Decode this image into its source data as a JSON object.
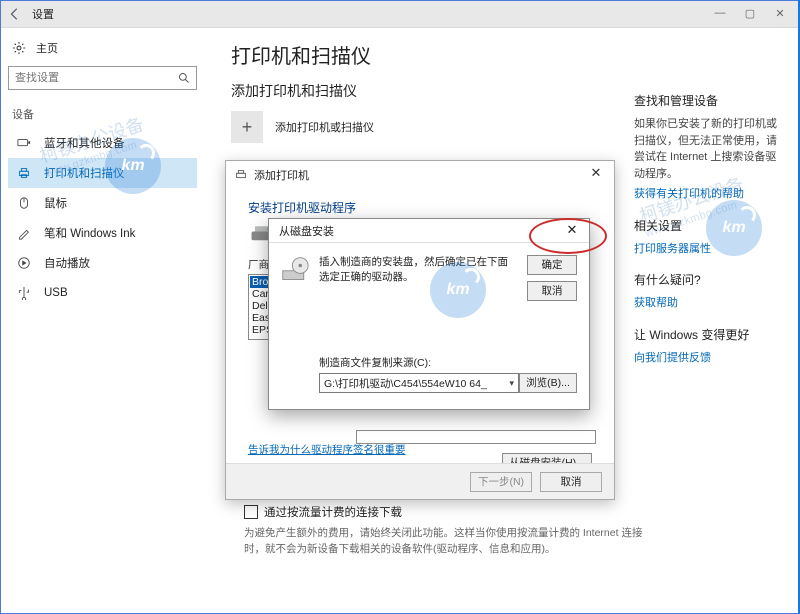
{
  "titlebar": {
    "title": "设置"
  },
  "home": {
    "label": "主页"
  },
  "search": {
    "placeholder": "查找设置"
  },
  "section_label": "设备",
  "nav": {
    "bluetooth": "蓝牙和其他设备",
    "printers": "打印机和扫描仪",
    "mouse": "鼠标",
    "pen": "笔和 Windows Ink",
    "autoplay": "自动播放",
    "usb": "USB"
  },
  "main": {
    "h1": "打印机和扫描仪",
    "h2": "添加打印机和扫描仪",
    "add_label": "添加打印机或扫描仪"
  },
  "right": {
    "h_manage": "查找和管理设备",
    "manage_text": "如果你已安装了新的打印机或扫描仪，但无法正常使用，请尝试在 Internet 上搜索设备驱动程序。",
    "link_help": "获得有关打印机的帮助",
    "h_related": "相关设置",
    "link_server": "打印服务器属性",
    "h_question": "有什么疑问?",
    "link_gethelp": "获取帮助",
    "h_better": "让 Windows 变得更好",
    "link_feedback": "向我们提供反馈"
  },
  "metered": {
    "label": "通过按流量计费的连接下载",
    "desc": "为避免产生额外的费用，请始终关闭此功能。这样当你使用按流量计费的 Internet 连接时，就不会为新设备下载相关的设备软件(驱动程序、信息和应用)。"
  },
  "wizard": {
    "title": "添加打印机",
    "heading": "安装打印机驱动程序",
    "col_mfr": "厂商",
    "mfrs": [
      "Brother",
      "Canon",
      "Dell",
      "Eastman",
      "EPSON"
    ],
    "btn_disk": "从磁盘安装(H)...",
    "sign_link": "告诉我为什么驱动程序签名很重要",
    "btn_next": "下一步(N)",
    "btn_cancel": "取消"
  },
  "disk": {
    "title": "从磁盘安装",
    "msg": "插入制造商的安装盘，然后确定已在下面选定正确的驱动器。",
    "ok": "确定",
    "cancel": "取消",
    "src_label": "制造商文件复制来源(C):",
    "src_value": "G:\\打印机驱动\\C454\\554eW10 64_",
    "browse": "浏览(B)..."
  },
  "watermark": {
    "text": "柯镁办公设备",
    "url": "www.gzkmbg.com",
    "logo": "km"
  }
}
